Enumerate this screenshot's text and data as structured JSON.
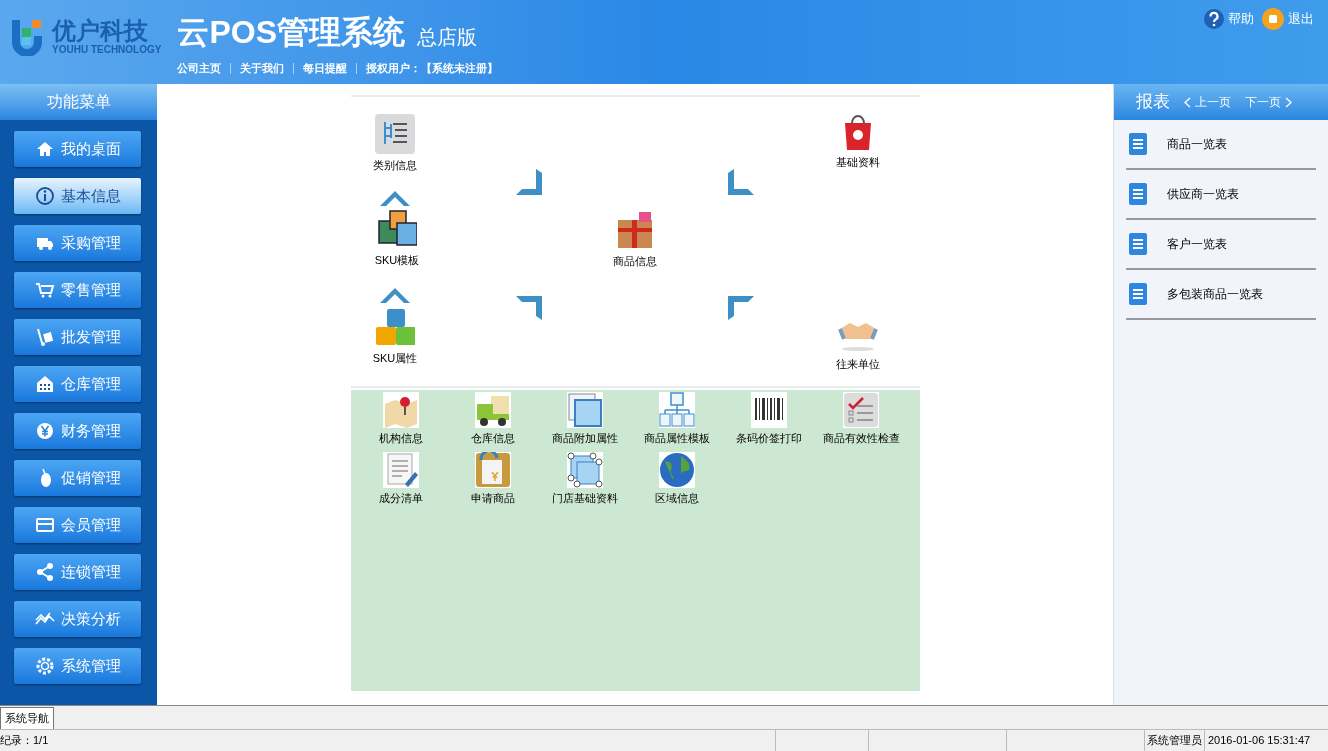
{
  "header": {
    "logo_text": "优户科技",
    "logo_subtext": "YOUHU TECHNOLOGY",
    "title": "云POS管理系统",
    "edition": "总店版",
    "links": [
      "公司主页",
      "关于我们",
      "每日提醒"
    ],
    "license_label": "授权用户：",
    "license_value": "【系统未注册】",
    "actions": [
      {
        "label": "帮助",
        "kind": "help"
      },
      {
        "label": "退出",
        "kind": "exit"
      }
    ]
  },
  "sidebar": {
    "title": "功能菜单",
    "items": [
      {
        "label": "我的桌面",
        "selected": false
      },
      {
        "label": "基本信息",
        "selected": true
      },
      {
        "label": "采购管理",
        "selected": false
      },
      {
        "label": "零售管理",
        "selected": false
      },
      {
        "label": "批发管理",
        "selected": false
      },
      {
        "label": "仓库管理",
        "selected": false
      },
      {
        "label": "财务管理",
        "selected": false
      },
      {
        "label": "促销管理",
        "selected": false
      },
      {
        "label": "会员管理",
        "selected": false
      },
      {
        "label": "连锁管理",
        "selected": false
      },
      {
        "label": "决策分析",
        "selected": false
      },
      {
        "label": "系统管理",
        "selected": false
      }
    ]
  },
  "diagram": {
    "nodes": [
      {
        "label": "类别信息"
      },
      {
        "label": "基础资料"
      },
      {
        "label": "SKU模板"
      },
      {
        "label": "商品信息"
      },
      {
        "label": "SKU属性"
      },
      {
        "label": "往来单位"
      }
    ]
  },
  "modules": [
    {
      "label": "机构信息"
    },
    {
      "label": "仓库信息"
    },
    {
      "label": "商品附加属性"
    },
    {
      "label": "商品属性模板"
    },
    {
      "label": "条码价签打印"
    },
    {
      "label": "商品有效性检查"
    },
    {
      "label": "成分清单"
    },
    {
      "label": "申请商品"
    },
    {
      "label": "门店基础资料"
    },
    {
      "label": "区域信息"
    }
  ],
  "reports": {
    "title": "报表",
    "prev": "上一页",
    "next": "下一页",
    "items": [
      {
        "label": "商品一览表"
      },
      {
        "label": "供应商一览表"
      },
      {
        "label": "客户一览表"
      },
      {
        "label": "多包装商品一览表"
      }
    ]
  },
  "bottom_tabs": [
    {
      "label": "系统导航",
      "selected": true
    }
  ],
  "status_bar": {
    "record": "纪录：1/1",
    "user": "系统管理员",
    "datetime": "2016-01-06 15:31:47"
  }
}
